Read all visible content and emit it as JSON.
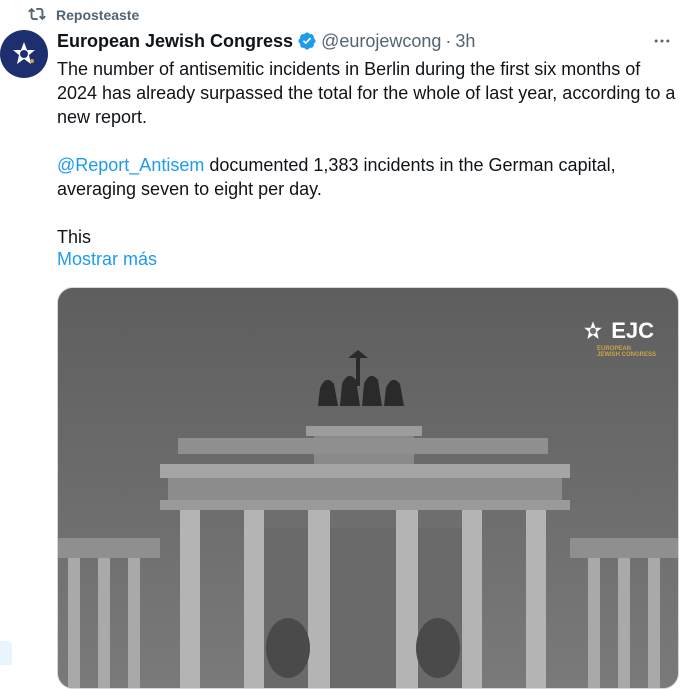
{
  "repost": {
    "label": "Reposteaste",
    "icon": "repost-icon"
  },
  "author": {
    "name": "European Jewish Congress",
    "handle": "@eurojewcong",
    "separator": "·",
    "time": "3h",
    "verified_icon": "verified-badge-icon",
    "avatar_icon": "ejc-star-logo-icon"
  },
  "more_icon": "more-options-icon",
  "body": {
    "paragraph1": "The number of antisemitic incidents in Berlin during the first six months of 2024 has already surpassed the total for the whole of last year, according to a new report.",
    "mention": "@Report_Antisem",
    "paragraph2_rest": " documented 1,383 incidents in the German capital, averaging seven to eight per day.",
    "paragraph3": "This",
    "show_more": "Mostrar más"
  },
  "media": {
    "logo_text": "EJC",
    "logo_subtext_line1": "EUROPEAN",
    "logo_subtext_line2": "JEWISH CONGRESS",
    "description": ""
  },
  "colors": {
    "link": "#1d9bf0",
    "secondary_text": "#536471",
    "verified": "#1d9bf0",
    "avatar_bg": "#1d2f6e"
  }
}
